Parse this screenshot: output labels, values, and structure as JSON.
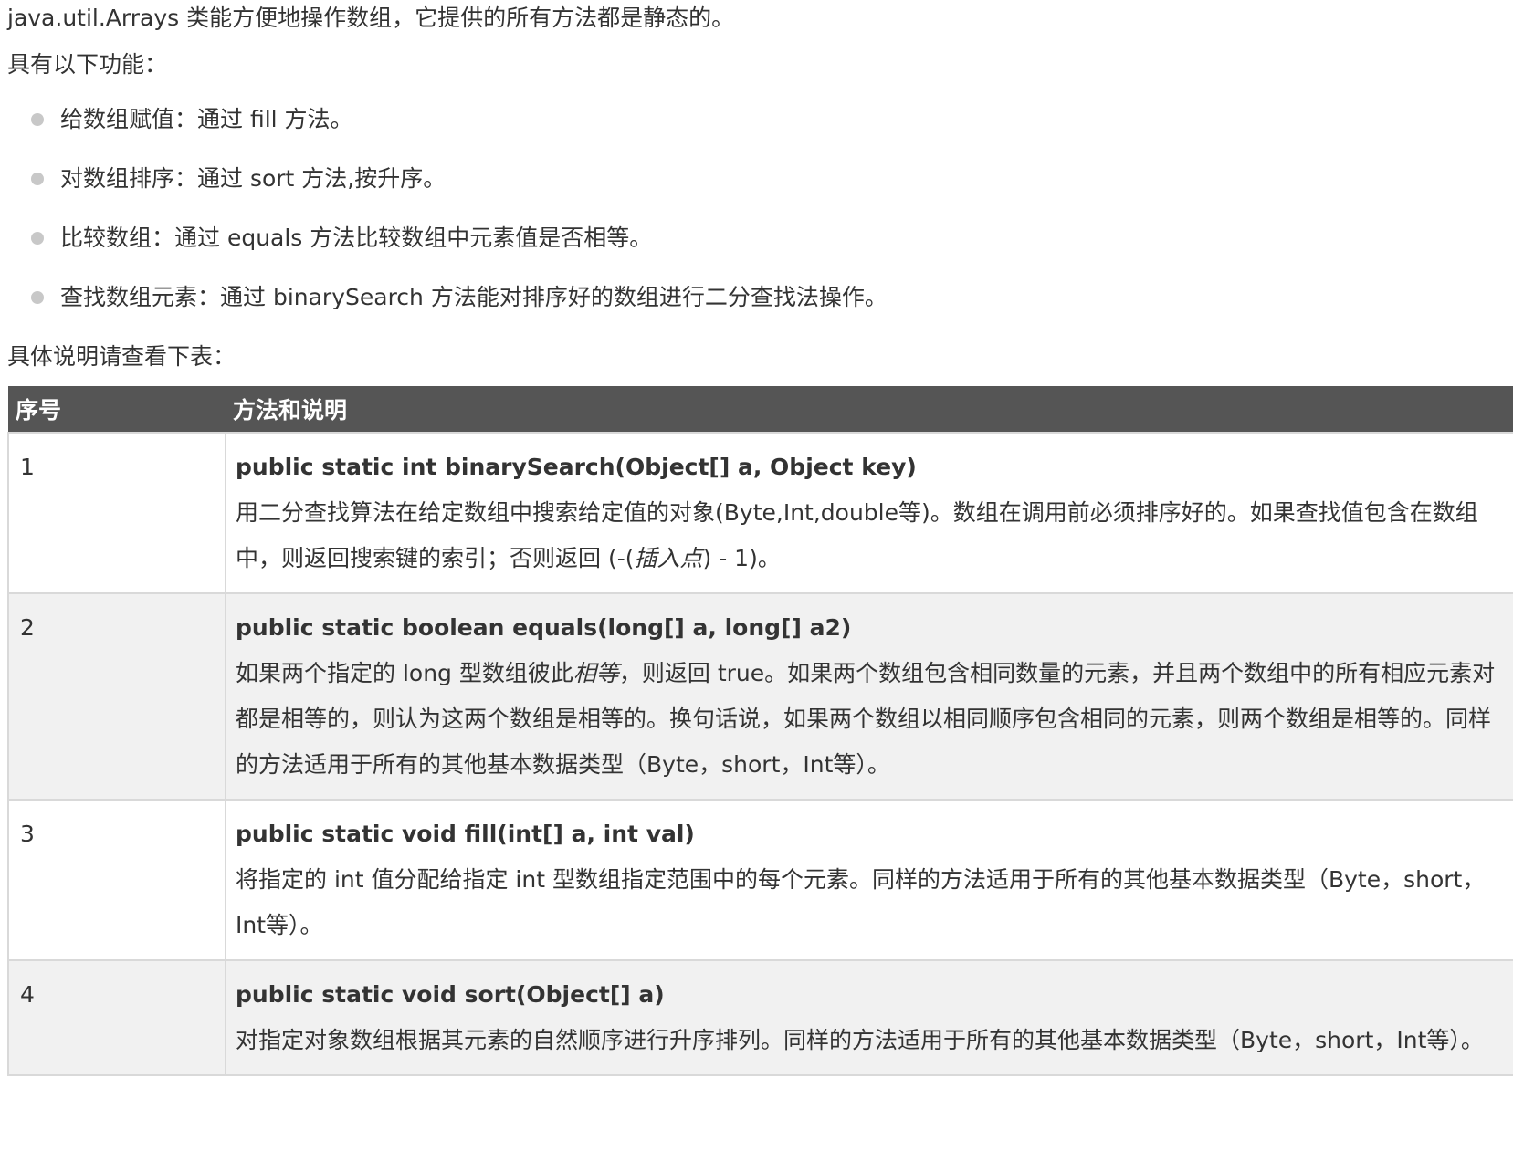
{
  "intro": {
    "line1": "java.util.Arrays 类能方便地操作数组，它提供的所有方法都是静态的。",
    "line2": "具有以下功能："
  },
  "features": [
    "给数组赋值：通过 fill 方法。",
    "对数组排序：通过 sort 方法,按升序。",
    "比较数组：通过 equals 方法比较数组中元素值是否相等。",
    "查找数组元素：通过 binarySearch 方法能对排序好的数组进行二分查找法操作。"
  ],
  "table_caption": "具体说明请查看下表：",
  "table": {
    "headers": [
      "序号",
      "方法和说明"
    ],
    "rows": [
      {
        "num": "1",
        "signature": "public static int binarySearch(Object[] a, Object key)",
        "desc_before": "用二分查找算法在给定数组中搜索给定值的对象(Byte,Int,double等)。数组在调用前必须排序好的。如果查找值包含在数组中，则返回搜索键的索引；否则返回 (-(",
        "desc_em": "插入点",
        "desc_after": ") - 1)。"
      },
      {
        "num": "2",
        "signature": "public static boolean equals(long[] a, long[] a2)",
        "desc_before": "如果两个指定的 long 型数组彼此",
        "desc_em": "相等",
        "desc_after": "，则返回 true。如果两个数组包含相同数量的元素，并且两个数组中的所有相应元素对都是相等的，则认为这两个数组是相等的。换句话说，如果两个数组以相同顺序包含相同的元素，则两个数组是相等的。同样的方法适用于所有的其他基本数据类型（Byte，short，Int等）。"
      },
      {
        "num": "3",
        "signature": "public static void fill(int[] a, int val)",
        "desc_before": "将指定的 int 值分配给指定 int 型数组指定范围中的每个元素。同样的方法适用于所有的其他基本数据类型（Byte，short，Int等）。",
        "desc_em": "",
        "desc_after": ""
      },
      {
        "num": "4",
        "signature": "public static void sort(Object[] a)",
        "desc_before": "对指定对象数组根据其元素的自然顺序进行升序排列。同样的方法适用于所有的其他基本数据类型（Byte，short，Int等）。",
        "desc_em": "",
        "desc_after": ""
      }
    ]
  }
}
